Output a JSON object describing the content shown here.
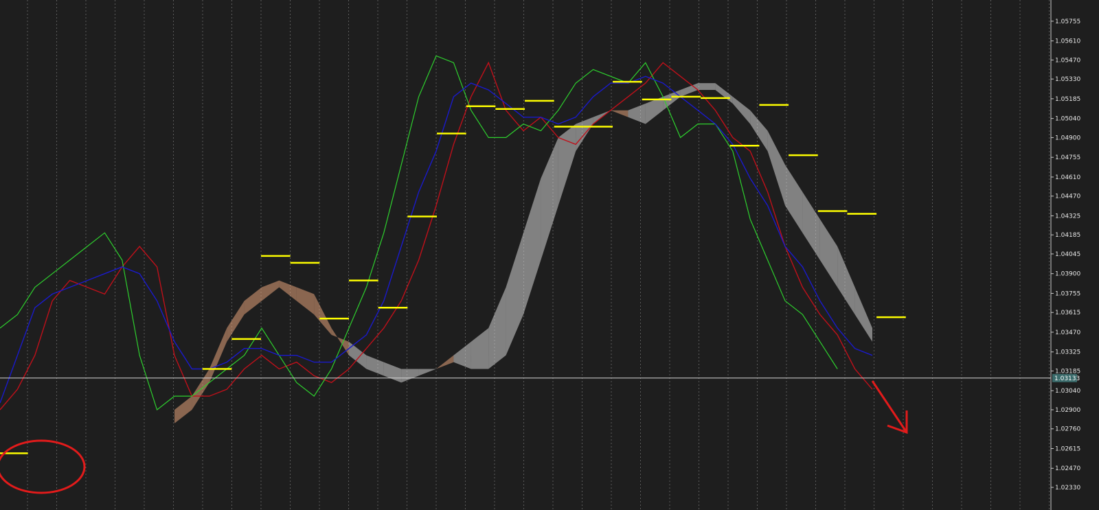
{
  "chart_data": {
    "type": "line",
    "chart_kind": "forex candlestick chart with Ichimoku cloud",
    "colors": {
      "background": "#1e1e1e",
      "price_line": "#c0101a",
      "chikou_span": "#2ed12e",
      "kijun_sen": "#1a1acc",
      "cloud_bullish": "#e3a27a",
      "cloud_bearish": "#d4d4d4",
      "pivot_levels": "#ffff00",
      "annotation": "#e21b1b",
      "grid": "#a9a9a9",
      "current_price_bg": "#3a6b6b"
    },
    "grid": "vertical dotted",
    "ylim": [
      1.0233,
      1.0583
    ],
    "y_ticks": [
      "1.05755",
      "1.05610",
      "1.05470",
      "1.05330",
      "1.05185",
      "1.05040",
      "1.04900",
      "1.04755",
      "1.04610",
      "1.04470",
      "1.04325",
      "1.04185",
      "1.04045",
      "1.03900",
      "1.03755",
      "1.03615",
      "1.03470",
      "1.03325",
      "1.03185",
      "1.03040",
      "1.02900",
      "1.02760",
      "1.02615",
      "1.02470",
      "1.02330"
    ],
    "current_price": "1.03133",
    "x": [
      0,
      25,
      50,
      75,
      100,
      125,
      150,
      175,
      200,
      225,
      250,
      275,
      300,
      325,
      350,
      375,
      400,
      425,
      450,
      475,
      500,
      525,
      550,
      575,
      600,
      625,
      650,
      675,
      700,
      725,
      750,
      775,
      800,
      825,
      850,
      875,
      900,
      925,
      950,
      975,
      1000,
      1025,
      1050,
      1075,
      1100,
      1125,
      1150,
      1175,
      1200,
      1225,
      1250
    ],
    "series": [
      {
        "role": "close",
        "values": [
          1.029,
          1.0305,
          1.033,
          1.037,
          1.0385,
          1.038,
          1.0375,
          1.0395,
          1.041,
          1.0395,
          1.033,
          1.03,
          1.03,
          1.0305,
          1.032,
          1.033,
          1.032,
          1.0325,
          1.0315,
          1.031,
          1.032,
          1.0335,
          1.035,
          1.037,
          1.04,
          1.044,
          1.0485,
          1.052,
          1.0545,
          1.051,
          1.0495,
          1.0505,
          1.049,
          1.0485,
          1.05,
          1.051,
          1.052,
          1.053,
          1.0545,
          1.0535,
          1.0525,
          1.051,
          1.049,
          1.048,
          1.045,
          1.041,
          1.038,
          1.036,
          1.0345,
          1.032,
          1.0305
        ]
      },
      {
        "role": "chikou",
        "values": [
          1.035,
          1.036,
          1.038,
          1.039,
          1.04,
          1.041,
          1.042,
          1.04,
          1.033,
          1.029,
          1.03,
          1.03,
          1.031,
          1.032,
          1.033,
          1.035,
          1.033,
          1.031,
          1.03,
          1.032,
          1.035,
          1.038,
          1.042,
          1.047,
          1.052,
          1.055,
          1.0545,
          1.051,
          1.049,
          1.049,
          1.05,
          1.0495,
          1.051,
          1.053,
          1.054,
          1.0535,
          1.053,
          1.0545,
          1.052,
          1.049,
          1.05,
          1.05,
          1.048,
          1.043,
          1.04,
          1.037,
          1.036,
          1.034,
          1.032,
          null,
          null
        ]
      },
      {
        "role": "kijun",
        "values": [
          1.0295,
          1.033,
          1.0365,
          1.0375,
          1.038,
          1.0385,
          1.039,
          1.0395,
          1.039,
          1.037,
          1.034,
          1.032,
          1.032,
          1.0325,
          1.0335,
          1.0335,
          1.033,
          1.033,
          1.0325,
          1.0325,
          1.0335,
          1.0345,
          1.037,
          1.041,
          1.045,
          1.048,
          1.052,
          1.053,
          1.0525,
          1.0515,
          1.0505,
          1.0505,
          1.05,
          1.0505,
          1.052,
          1.053,
          1.053,
          1.0535,
          1.053,
          1.052,
          1.051,
          1.05,
          1.0485,
          1.046,
          1.044,
          1.041,
          1.0395,
          1.037,
          1.035,
          1.0335,
          1.033
        ]
      },
      {
        "role": "senkou_a",
        "values": [
          1.029,
          1.03,
          1.032,
          1.035,
          1.037,
          1.038,
          1.0385,
          1.038,
          1.0375,
          1.035,
          1.033,
          1.032,
          1.0315,
          1.031,
          1.0315,
          1.032,
          1.0325,
          1.032,
          1.032,
          1.033,
          1.036,
          1.04,
          1.044,
          1.048,
          1.05,
          1.051,
          1.0505,
          1.05,
          1.051,
          1.052,
          1.0525,
          1.0525,
          1.0515,
          1.05,
          1.048,
          1.044,
          1.042,
          1.04,
          1.038,
          1.036,
          1.034
        ]
      },
      {
        "role": "senkou_b",
        "values": [
          1.028,
          1.029,
          1.031,
          1.034,
          1.036,
          1.037,
          1.038,
          1.037,
          1.036,
          1.0345,
          1.034,
          1.033,
          1.0325,
          1.032,
          1.032,
          1.032,
          1.033,
          1.034,
          1.035,
          1.038,
          1.042,
          1.046,
          1.049,
          1.05,
          1.0505,
          1.051,
          1.051,
          1.0515,
          1.052,
          1.0525,
          1.053,
          1.053,
          1.052,
          1.051,
          1.0495,
          1.047,
          1.045,
          1.043,
          1.041,
          1.038,
          1.035
        ]
      }
    ],
    "pivot_levels": [
      {
        "x_from": 0,
        "x_to": 40,
        "y": 1.0258
      },
      {
        "x_from": 290,
        "x_to": 332,
        "y": 1.032
      },
      {
        "x_from": 332,
        "x_to": 374,
        "y": 1.0342
      },
      {
        "x_from": 374,
        "x_to": 416,
        "y": 1.0403
      },
      {
        "x_from": 416,
        "x_to": 458,
        "y": 1.0398
      },
      {
        "x_from": 458,
        "x_to": 500,
        "y": 1.0357
      },
      {
        "x_from": 500,
        "x_to": 542,
        "y": 1.0385
      },
      {
        "x_from": 542,
        "x_to": 584,
        "y": 1.0365
      },
      {
        "x_from": 584,
        "x_to": 626,
        "y": 1.0432
      },
      {
        "x_from": 626,
        "x_to": 668,
        "y": 1.0493
      },
      {
        "x_from": 668,
        "x_to": 710,
        "y": 1.0513
      },
      {
        "x_from": 710,
        "x_to": 752,
        "y": 1.0511
      },
      {
        "x_from": 752,
        "x_to": 794,
        "y": 1.0517
      },
      {
        "x_from": 794,
        "x_to": 836,
        "y": 1.0498
      },
      {
        "x_from": 836,
        "x_to": 878,
        "y": 1.0498
      },
      {
        "x_from": 878,
        "x_to": 920,
        "y": 1.0531
      },
      {
        "x_from": 920,
        "x_to": 962,
        "y": 1.0518
      },
      {
        "x_from": 962,
        "x_to": 1004,
        "y": 1.052
      },
      {
        "x_from": 1004,
        "x_to": 1046,
        "y": 1.0519
      },
      {
        "x_from": 1046,
        "x_to": 1088,
        "y": 1.0484
      },
      {
        "x_from": 1088,
        "x_to": 1130,
        "y": 1.0514
      },
      {
        "x_from": 1130,
        "x_to": 1172,
        "y": 1.0477
      },
      {
        "x_from": 1172,
        "x_to": 1214,
        "y": 1.0436
      },
      {
        "x_from": 1214,
        "x_to": 1256,
        "y": 1.0434
      },
      {
        "x_from": 1256,
        "x_to": 1298,
        "y": 1.0358
      }
    ]
  }
}
